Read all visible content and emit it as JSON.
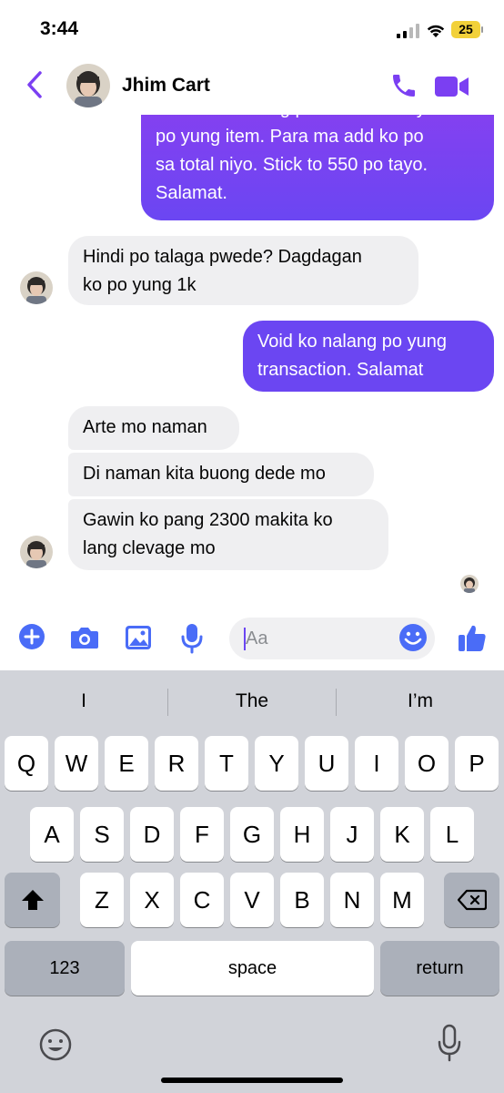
{
  "status_bar": {
    "time": "3:44",
    "battery": "25"
  },
  "header": {
    "contact_name": "Jhim Cart"
  },
  "messages": [
    {
      "from": "me",
      "text": "Pa fill out nalang po if kukunin niyo po yung item. Para ma add ko po sa total niyo. Stick to 550 po tayo. Salamat.",
      "lines": [
        "Pa fill out nalang po if kukunin niyo",
        "po yung item. Para ma add ko po",
        "sa total niyo. Stick to 550 po tayo.",
        "Salamat."
      ]
    },
    {
      "from": "them",
      "lines": [
        "Hindi po talaga pwede? Dagdagan",
        "ko po yung 1k"
      ]
    },
    {
      "from": "me",
      "lines": [
        "Void ko nalang po yung",
        "transaction. Salamat"
      ]
    },
    {
      "from": "them",
      "lines": [
        "Arte mo naman"
      ]
    },
    {
      "from": "them",
      "lines": [
        "Di naman kita buong dede mo"
      ]
    },
    {
      "from": "them",
      "lines": [
        "Gawin ko pang 2300 makita ko",
        "lang clevage mo"
      ]
    }
  ],
  "composer": {
    "placeholder": "Aa"
  },
  "keyboard": {
    "suggestions": [
      "I",
      "The",
      "I’m"
    ],
    "row1": [
      "Q",
      "W",
      "E",
      "R",
      "T",
      "Y",
      "U",
      "I",
      "O",
      "P"
    ],
    "row2": [
      "A",
      "S",
      "D",
      "F",
      "G",
      "H",
      "J",
      "K",
      "L"
    ],
    "row3": [
      "Z",
      "X",
      "C",
      "V",
      "B",
      "N",
      "M"
    ],
    "numbers_key": "123",
    "space_key": "space",
    "return_key": "return"
  },
  "colors": {
    "accent": "#7b3ff2",
    "outgoing_top": "#8a3ff0",
    "outgoing_bottom": "#6b46f2",
    "incoming": "#efeff1",
    "battery": "#f2d13a"
  },
  "icons": [
    "back-chevron-icon",
    "phone-icon",
    "video-camera-icon",
    "plus-icon",
    "camera-icon",
    "image-icon",
    "microphone-icon",
    "emoji-icon",
    "thumbs-up-icon",
    "shift-icon",
    "delete-icon",
    "keyboard-emoji-icon",
    "dictation-mic-icon"
  ]
}
